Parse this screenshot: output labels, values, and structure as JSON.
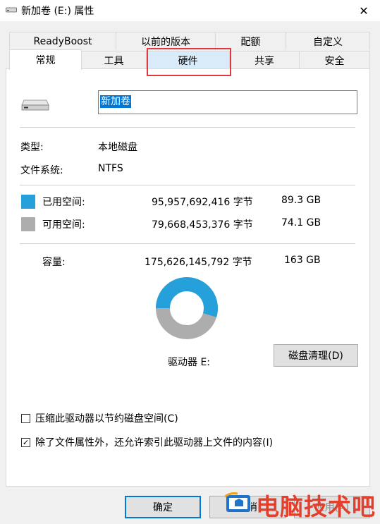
{
  "window": {
    "title": "新加卷 (E:) 属性",
    "close_glyph": "✕"
  },
  "tabs_row1": [
    "ReadyBoost",
    "以前的版本",
    "配额",
    "自定义"
  ],
  "tabs_row2": [
    "常规",
    "工具",
    "硬件",
    "共享",
    "安全"
  ],
  "selected_tab": "常规",
  "highlighted_tab": "硬件",
  "volume": {
    "name": "新加卷",
    "icon": "drive-icon"
  },
  "info": {
    "type_label": "类型:",
    "type_value": "本地磁盘",
    "fs_label": "文件系统:",
    "fs_value": "NTFS"
  },
  "space": {
    "used": {
      "label": "已用空间:",
      "bytes": "95,957,692,416 字节",
      "size": "89.3 GB",
      "color": "#26a0da"
    },
    "free": {
      "label": "可用空间:",
      "bytes": "79,668,453,376 字节",
      "size": "74.1 GB",
      "color": "#adadad"
    },
    "capacity": {
      "label": "容量:",
      "bytes": "175,626,145,792 字节",
      "size": "163 GB"
    },
    "used_fraction": 0.546
  },
  "drive_label": "驱动器 E:",
  "cleanup_button": "磁盘清理(D)",
  "options": {
    "compress": {
      "label": "压缩此驱动器以节约磁盘空间(C)",
      "checked": false
    },
    "index": {
      "label": "除了文件属性外，还允许索引此驱动器上文件的内容(I)",
      "checked": true
    }
  },
  "buttons": {
    "ok": "确定",
    "cancel": "取消",
    "apply": "应用(A)"
  },
  "watermark": {
    "text": "电脑技术吧"
  }
}
